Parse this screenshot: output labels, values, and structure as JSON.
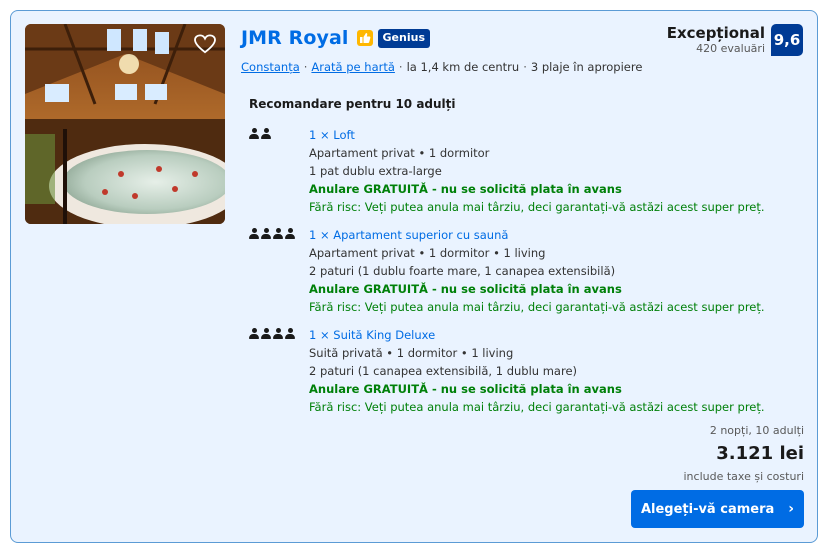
{
  "listing": {
    "title": "JMR Royal",
    "genius_label": "Genius",
    "location": {
      "city": "Constanța",
      "map_link": "Arată pe hartă",
      "distance": "la 1,4 km de centru",
      "beaches": "3 plaje în apropiere"
    },
    "rating": {
      "label": "Excepțional",
      "reviews": "420 evaluări",
      "score": "9,6"
    },
    "recommendation": "Recomandare pentru 10 adulți",
    "rooms": [
      {
        "name": "1 × Loft",
        "occupancy": 2,
        "type": "Apartament privat • 1 dormitor",
        "beds": "1 pat dublu extra-large",
        "cancel": "Anulare GRATUITĂ - nu se solicită plata în avans",
        "no_risk": "Fără risc: Veți putea anula mai târziu, deci garantați-vă astăzi acest super preț."
      },
      {
        "name": "1 × Apartament superior cu saună",
        "occupancy": 4,
        "type": "Apartament privat • 1 dormitor • 1 living",
        "beds": "2 paturi (1 dublu foarte mare, 1 canapea extensibilă)",
        "cancel": "Anulare GRATUITĂ - nu se solicită plata în avans",
        "no_risk": "Fără risc: Veți putea anula mai târziu, deci garantați-vă astăzi acest super preț."
      },
      {
        "name": "1 × Suită King Deluxe",
        "occupancy": 4,
        "type": "Suită privată • 1 dormitor • 1 living",
        "beds": "2 paturi (1 canapea extensibilă, 1 dublu mare)",
        "cancel": "Anulare GRATUITĂ - nu se solicită plata în avans",
        "no_risk": "Fără risc: Veți putea anula mai târziu, deci garantați-vă astăzi acest super preț."
      }
    ],
    "price": {
      "nights_guests": "2 nopți, 10 adulți",
      "amount": "3.121 lei",
      "taxes": "include taxe și costuri"
    },
    "cta_label": "Alegeți-vă camera"
  },
  "colors": {
    "accent": "#006ce4",
    "brand_dark": "#003b95",
    "success": "#008009",
    "card_bg": "#eaf3ff",
    "genius_badge": "#003b95",
    "bcom_badge": "#ffb700"
  },
  "icons": {
    "favorite": "heart-outline-icon",
    "preferred": "thumbs-up-badge-icon",
    "occupancy": "person-icon",
    "cta": "chevron-right-icon"
  }
}
